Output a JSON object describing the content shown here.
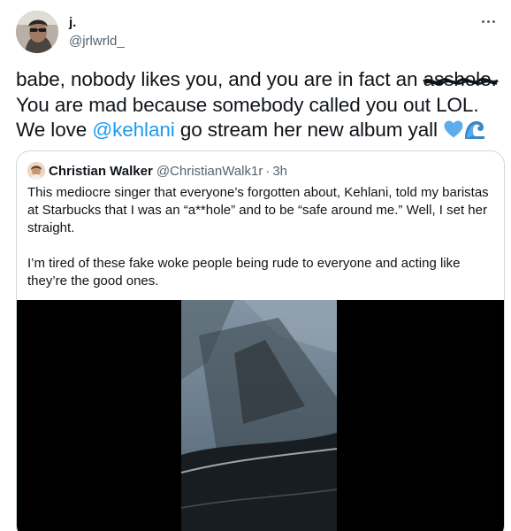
{
  "tweet": {
    "display_name": "j.",
    "handle": "@jrlwrld_",
    "more_label": "More",
    "text": {
      "line1_prefix": "babe, nobody likes you, and you are in fact an ",
      "censored_word": "asshole",
      "line1_suffix": ".",
      "line2": "You are mad because somebody called you out LOL.",
      "line3_prefix": "We love ",
      "mention": "@kehlani",
      "line3_suffix": " go stream her new album yall",
      "emoji_names": [
        "blue-heart-icon",
        "water-wave-icon"
      ]
    }
  },
  "quote": {
    "display_name": "Christian Walker",
    "handle": "@ChristianWalk1r",
    "separator": "·",
    "time": "3h",
    "paragraph1": "This mediocre singer that everyone’s forgotten about, Kehlani, told my baristas at Starbucks that I was an “a**hole” and to be “safe around me.” Well, I set her straight.",
    "paragraph2": "I’m tired of these fake woke people being rude to everyone and acting like they’re the good ones."
  },
  "colors": {
    "text": "#0f1419",
    "secondary": "#536471",
    "link": "#1d9bf0",
    "border": "#cfd9de",
    "media_bg": "#000000"
  }
}
